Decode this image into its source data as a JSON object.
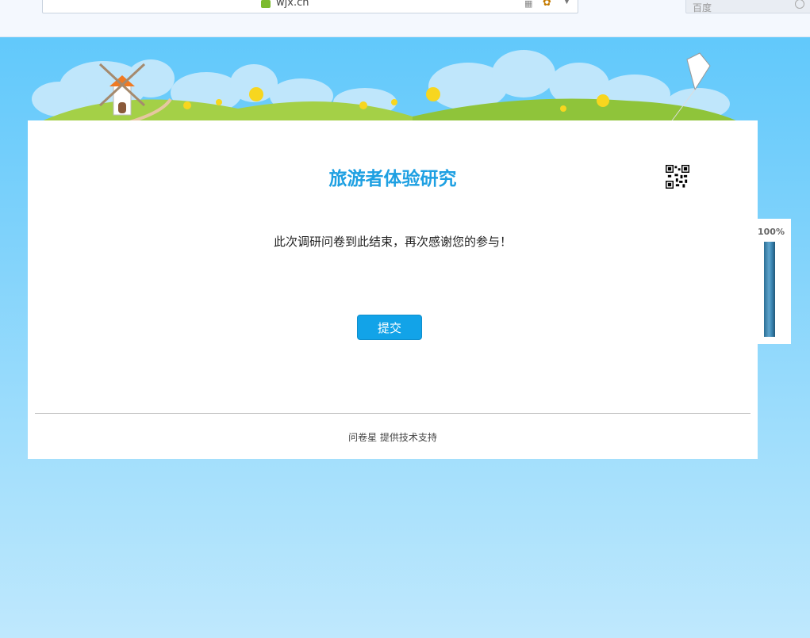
{
  "browser": {
    "url": "wjx.cn",
    "search_placeholder": "百度"
  },
  "survey": {
    "title": "旅游者体验研究",
    "end_message": "此次调研问卷到此结束，再次感谢您的参与！",
    "submit_label": "提交",
    "footer": "问卷星 提供技术支持"
  },
  "progress": {
    "label": "100%",
    "value": 1.0
  },
  "colors": {
    "title": "#1ea0e2",
    "button": "#12a3e8",
    "background_top": "#5cc7fb",
    "background_bottom": "#bfe8fd",
    "progress_fill": "#3a86b3"
  },
  "icons": [
    "lock-icon",
    "qr-mini-icon",
    "extension-icon",
    "dropdown-icon",
    "search-icon",
    "qr-code-icon",
    "windmill",
    "kite"
  ]
}
